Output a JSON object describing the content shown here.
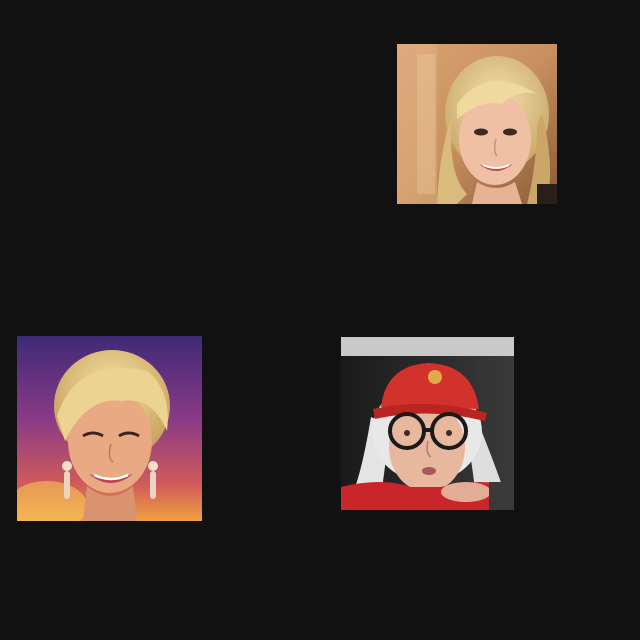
{
  "page": {
    "background_color": "#111111"
  },
  "photos": [
    {
      "icon": "portrait-blonde-woman-smiling",
      "palette": {
        "background": "#c9905f",
        "hair": "#e6cf92",
        "skin": "#f0c0a4"
      }
    },
    {
      "icon": "portrait-short-blonde-hair-woman",
      "palette": {
        "background_top": "#4a2a78",
        "background_bottom": "#e07a3a",
        "hair": "#e9cf88",
        "skin": "#e9a982"
      }
    },
    {
      "icon": "portrait-woman-red-cap-glasses",
      "palette": {
        "top_strip": "#c9c9c9",
        "background": "#202020",
        "cap": "#d3312c",
        "hair": "#e8e8e8",
        "skin": "#e7b79e",
        "jacket": "#c8262a"
      }
    }
  ]
}
